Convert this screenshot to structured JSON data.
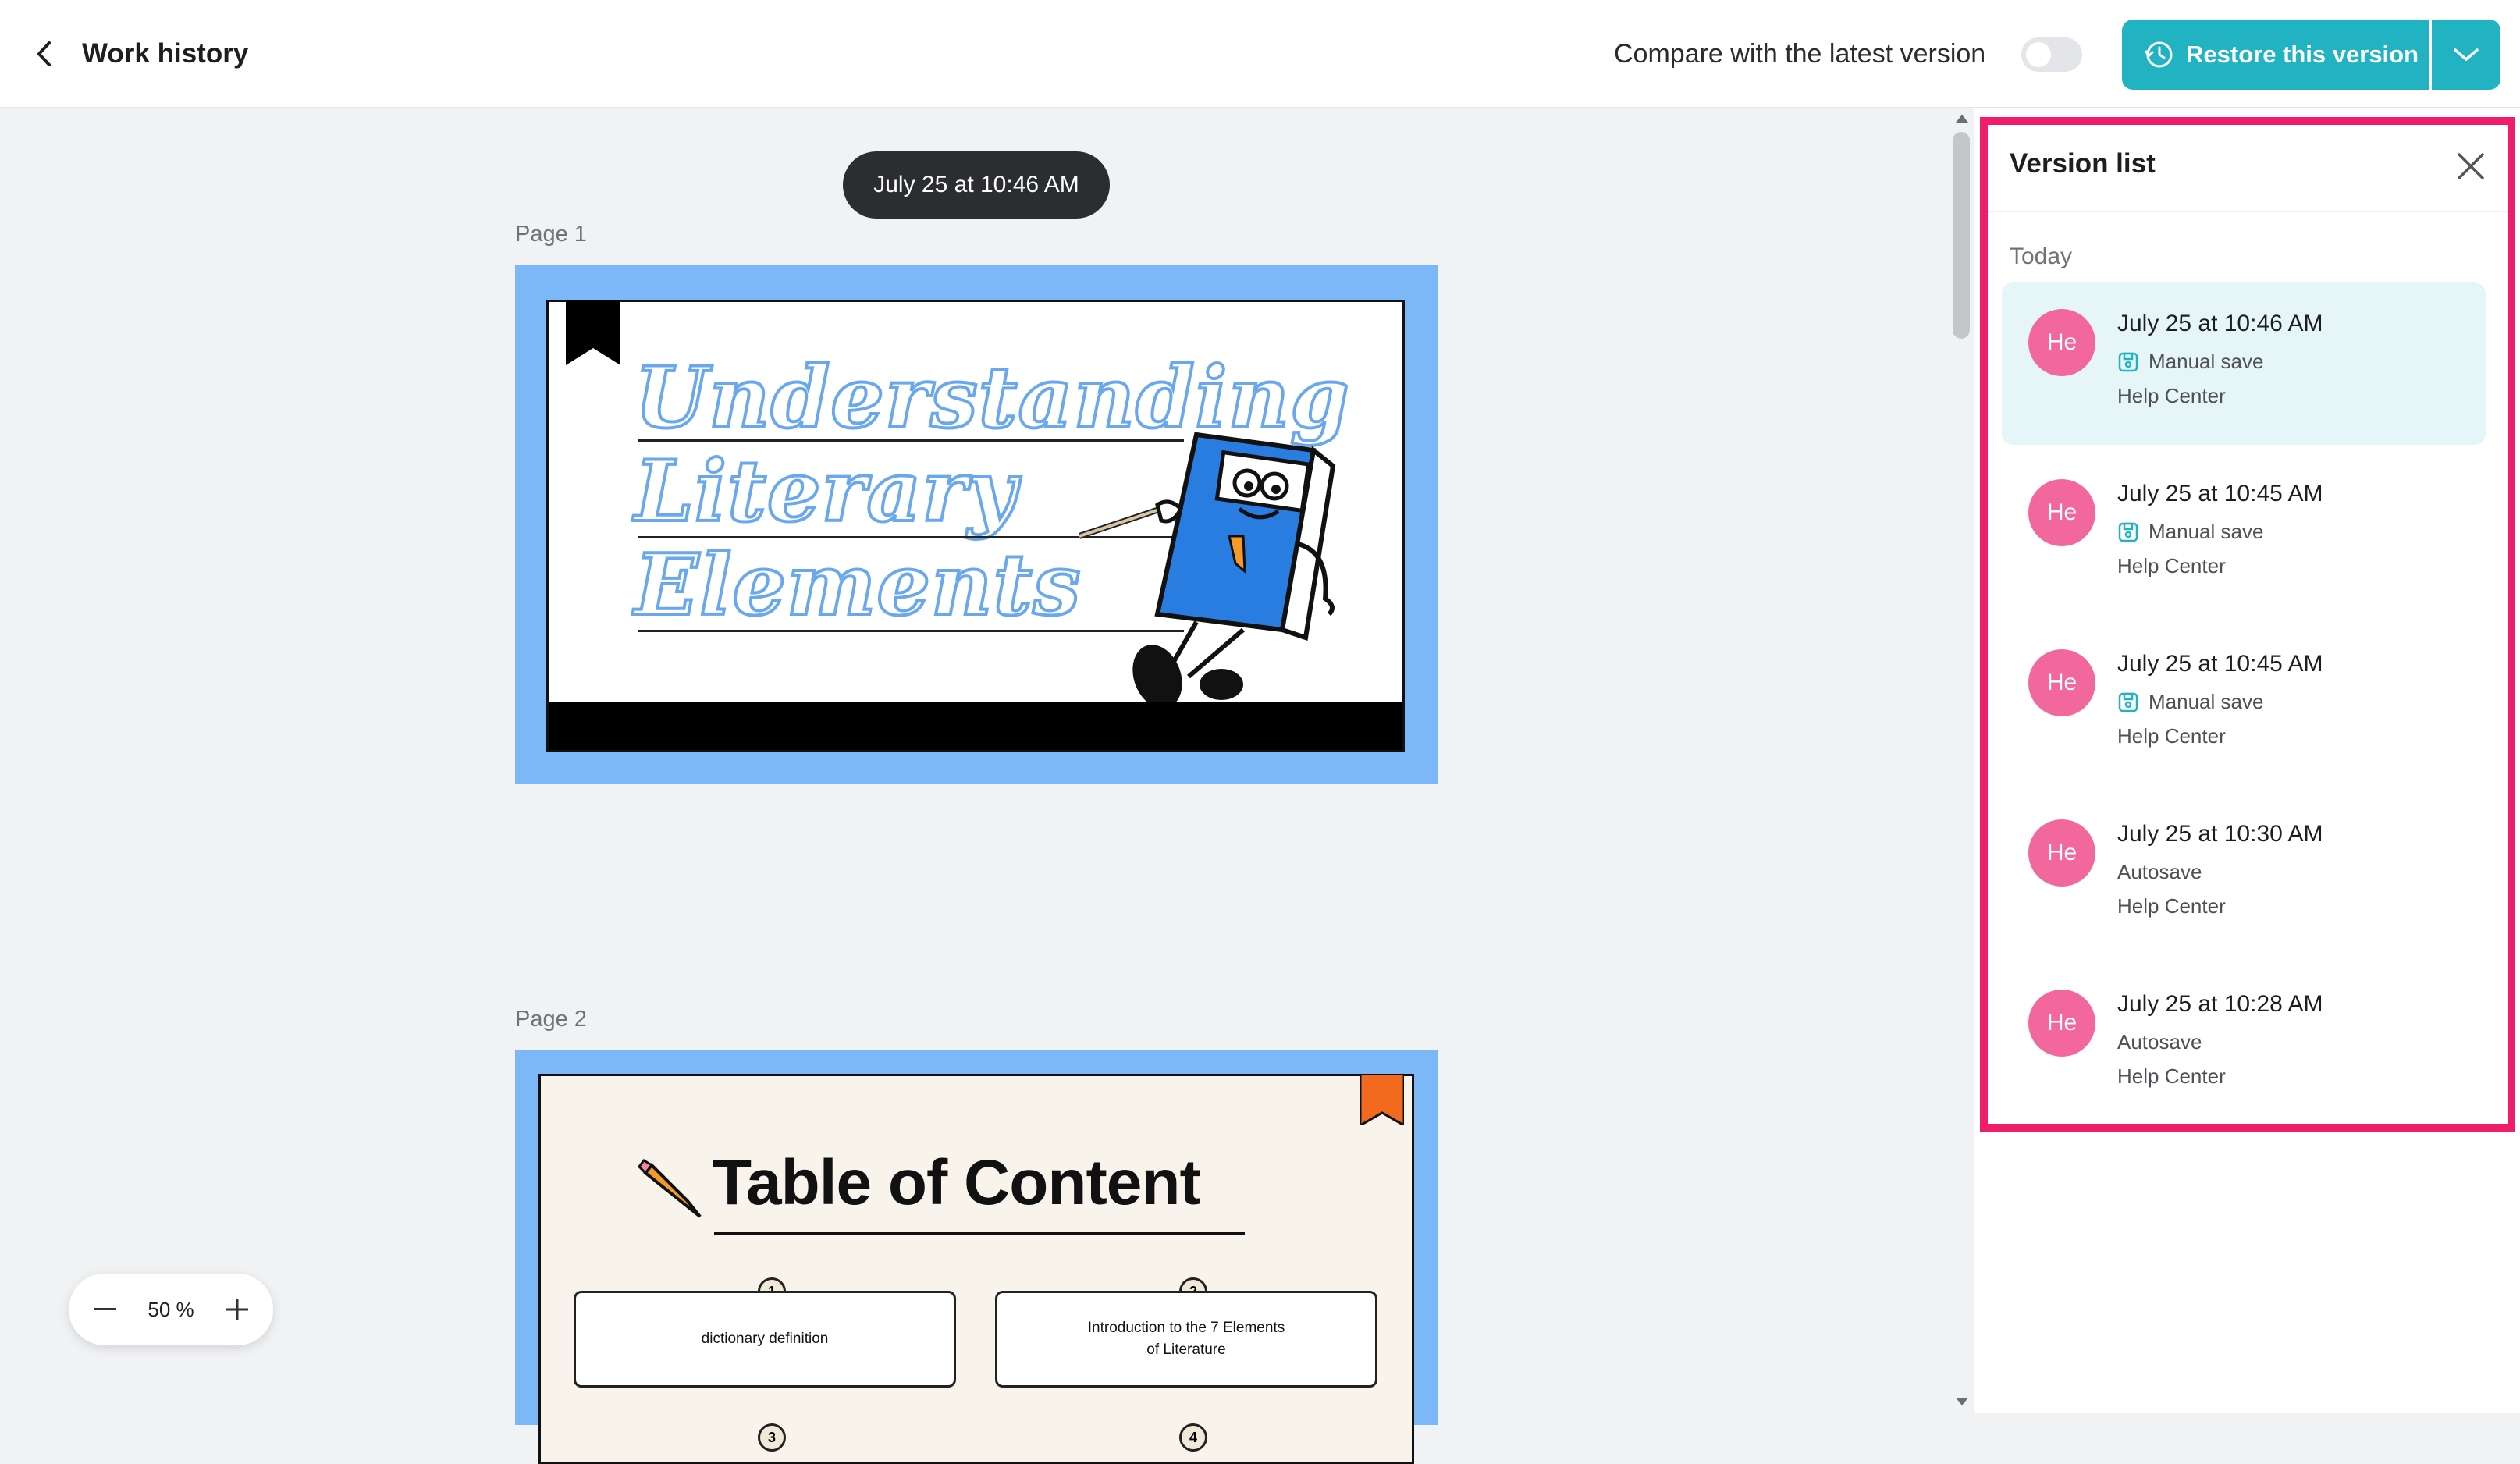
{
  "header": {
    "title": "Work history",
    "compare_label": "Compare with the latest version",
    "restore_label": "Restore this version",
    "accent": "#21b3c2"
  },
  "canvas": {
    "current_version": "July 25 at 10:46 AM",
    "pages": [
      {
        "label": "Page 1",
        "title_lines": [
          "Understanding",
          "Literary",
          "Elements"
        ]
      },
      {
        "label": "Page 2",
        "title": "Table of Content",
        "items": [
          {
            "num": "1",
            "text": "dictionary definition"
          },
          {
            "num": "2",
            "text": "Introduction to the 7 Elements of Literature"
          }
        ],
        "partial_nums": [
          "3",
          "4"
        ]
      }
    ],
    "zoom": {
      "value": "50",
      "unit": "%"
    }
  },
  "version_panel": {
    "title": "Version list",
    "group_label": "Today",
    "highlight_color": "#f01d6b",
    "items": [
      {
        "avatar": "He",
        "date": "July 25 at 10:46 AM",
        "type": "Manual save",
        "user": "Help Center",
        "active": true
      },
      {
        "avatar": "He",
        "date": "July 25 at 10:45 AM",
        "type": "Manual save",
        "user": "Help Center",
        "active": false
      },
      {
        "avatar": "He",
        "date": "July 25 at 10:45 AM",
        "type": "Manual save",
        "user": "Help Center",
        "active": false
      },
      {
        "avatar": "He",
        "date": "July 25 at 10:30 AM",
        "type": "Autosave",
        "user": "Help Center",
        "active": false
      },
      {
        "avatar": "He",
        "date": "July 25 at 10:28 AM",
        "type": "Autosave",
        "user": "Help Center",
        "active": false
      }
    ]
  }
}
